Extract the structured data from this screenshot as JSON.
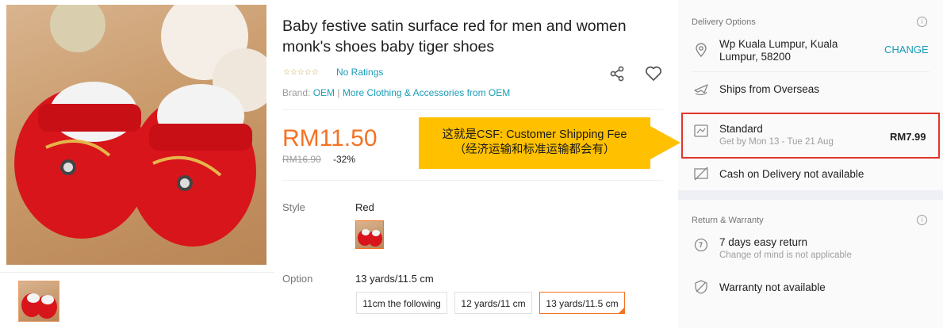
{
  "product": {
    "title": "Baby festive satin surface red for men and women monk's shoes baby tiger shoes",
    "stars": "☆☆☆☆☆",
    "ratings": "No Ratings",
    "brand_label": "Brand:",
    "brand": "OEM",
    "brand_separator": "|",
    "more_link": "More Clothing & Accessories from OEM",
    "price": "RM11.50",
    "old_price": "RM16.90",
    "discount": "-32%",
    "style_label": "Style",
    "style_value": "Red",
    "option_label": "Option",
    "option_value": "13 yards/11.5 cm",
    "options": [
      "11cm the following",
      "12 yards/11 cm",
      "13 yards/11.5 cm"
    ]
  },
  "annotation": {
    "line1": "这就是CSF: Customer Shipping Fee",
    "line2": "（经济运输和标准运输都会有）"
  },
  "delivery": {
    "section_title": "Delivery Options",
    "address_line1": "Wp Kuala Lumpur, Kuala",
    "address_line2": "Lumpur, 58200",
    "change": "CHANGE",
    "ships_from": "Ships from Overseas",
    "standard": "Standard",
    "standard_eta": "Get by Mon 13 - Tue 21 Aug",
    "standard_price": "RM7.99",
    "cod": "Cash on Delivery not available"
  },
  "warranty": {
    "section_title": "Return & Warranty",
    "return_title": "7 days easy return",
    "return_sub": "Change of mind is not applicable",
    "warranty": "Warranty not available"
  },
  "icons": {
    "info": "info-icon",
    "location": "location-pin-icon",
    "plane": "plane-icon",
    "truck": "truck-icon",
    "cash": "cash-icon",
    "return": "return-icon",
    "shield": "shield-icon",
    "share": "share-icon",
    "heart": "heart-icon"
  },
  "colors": {
    "accent": "#f57224",
    "link": "#1a9cb7",
    "callout": "#ffc000",
    "highlight": "#e2352a"
  }
}
